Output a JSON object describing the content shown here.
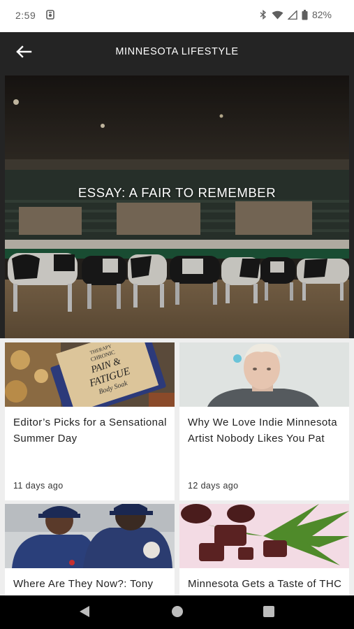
{
  "status_bar": {
    "time": "2:59",
    "battery": "82%"
  },
  "app_bar": {
    "title": "MINNESOTA LIFESTYLE",
    "back_icon": "arrow-left-icon"
  },
  "hero": {
    "title": "ESSAY: A FAIR TO REMEMBER",
    "image": "cattle-show-arena-photo"
  },
  "cards": [
    {
      "title": "Editor’s Picks for a Sensational Summer Day",
      "date": "11 days ago",
      "image": "body-soak-product-photo"
    },
    {
      "title": "Why We Love Indie Minnesota Artist Nobody Likes You Pat",
      "date": "12 days ago",
      "image": "artist-portrait-photo"
    },
    {
      "title": "Where Are They Now?: Tony Oliva",
      "date": "",
      "image": "baseball-players-photo"
    },
    {
      "title": "Minnesota Gets a Taste of THC",
      "date": "",
      "image": "cannabis-chocolate-photo"
    }
  ],
  "product_label": {
    "brand": "THERAPY",
    "line1": "CHRONIC",
    "line2": "PAIN &",
    "line3": "FATIGUE",
    "line4": "Body Soak"
  },
  "nav_bar": {
    "back_icon": "triangle-back-icon",
    "home_icon": "circle-home-icon",
    "recents_icon": "square-recents-icon"
  },
  "colors": {
    "app_bar": "#242424",
    "grid_bg": "#eeeeee",
    "card_bg": "#ffffff"
  }
}
